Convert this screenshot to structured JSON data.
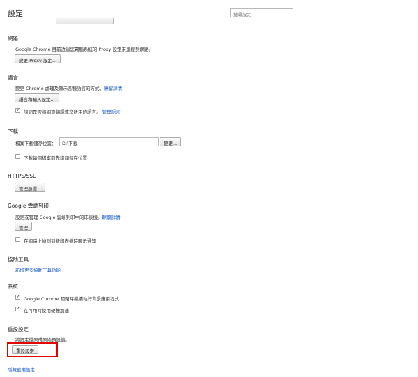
{
  "header": {
    "title": "設定",
    "search_placeholder": "搜尋設定"
  },
  "network": {
    "title": "網路",
    "description": "Google Chrome 目前透過您電腦系統的 Proxy 設定來連線到網路。",
    "proxy_button": "變更 Proxy 設定..."
  },
  "language": {
    "title": "語言",
    "description": "變更 Chrome 處理及顯示各種語言的方式。",
    "learn_more": "瞭解詳情",
    "input_button": "語言和輸入設定...",
    "translate_checkbox": {
      "label": "詢問是否將網頁翻譯成您所用的語言。",
      "checked": true
    },
    "manage_languages": "管理語言"
  },
  "downloads": {
    "title": "下載",
    "location_label": "檔案下載儲存位置：",
    "location_value": "D:\\下載",
    "change_button": "變更...",
    "ask_checkbox": {
      "label": "下載每個檔案前先詢問儲存位置",
      "checked": false
    }
  },
  "https": {
    "title": "HTTPS/SSL",
    "manage_button": "管理憑證..."
  },
  "cloud_print": {
    "title": "Google 雲端列印",
    "description": "設定或管理 Google 雲端列印中的印表機。",
    "learn_more": "瞭解詳情",
    "manage_button": "管理",
    "notify_checkbox": {
      "label": "在網路上偵測到新印表機時顯示通知",
      "checked": true
    }
  },
  "accessibility": {
    "title": "協助工具",
    "add_link": "新增更多協助工具功能"
  },
  "system": {
    "title": "系統",
    "background_checkbox": {
      "label": "Google Chrome 關閉時繼續執行背景應用程式",
      "checked": true
    },
    "hardware_checkbox": {
      "label": "在可用時使用硬體加速",
      "checked": true
    }
  },
  "reset": {
    "title": "重設設定",
    "description": "將設定還原成原始預設值。",
    "reset_button": "重設設定"
  },
  "footer": {
    "hide_advanced": "隱藏進階設定..."
  },
  "colors": {
    "link": "#1155cc",
    "highlight": "#e00000"
  }
}
